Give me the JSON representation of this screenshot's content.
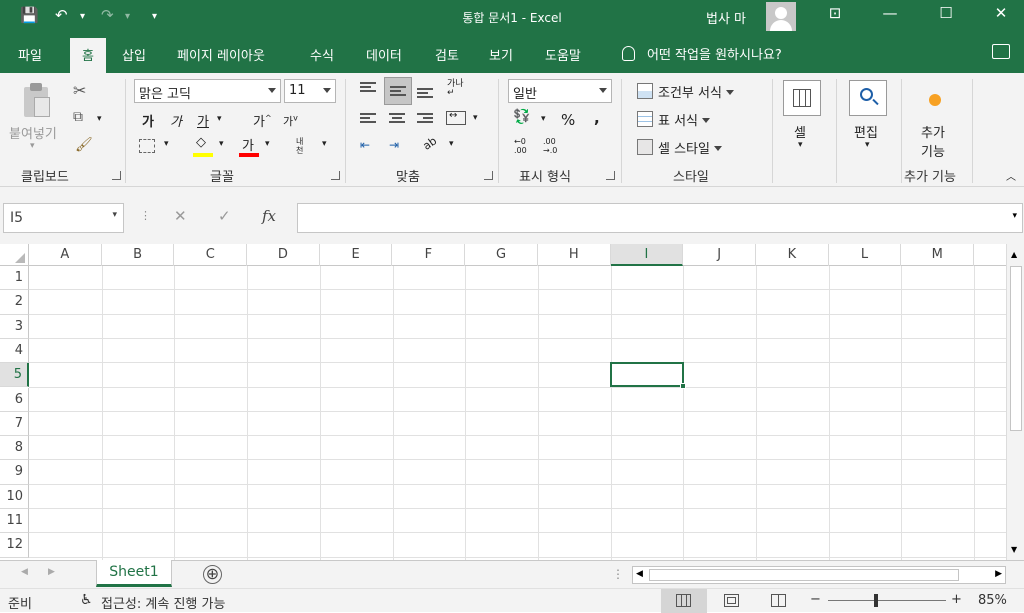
{
  "titlebar": {
    "doc_title": "통합 문서1  -  Excel",
    "user_name": "법사 마",
    "quick_access": {
      "save": "💾",
      "undo": "↶",
      "redo": "↷",
      "customize": "▾"
    },
    "window": {
      "ribbon_display": "⊡",
      "minimize": "—",
      "restore": "☐",
      "close": "✕"
    }
  },
  "tabs": [
    "파일",
    "홈",
    "삽입",
    "페이지 레이아웃",
    "수식",
    "데이터",
    "검토",
    "보기",
    "도움말"
  ],
  "active_tab": "홈",
  "tell_me": "어떤 작업을 원하시나요?",
  "ribbon": {
    "clipboard": {
      "paste_label": "붙여넣기",
      "group_label": "클립보드"
    },
    "font": {
      "font_name": "맑은 고딕",
      "font_size": "11",
      "bold": "가",
      "italic": "가",
      "underline": "가",
      "grow": "가",
      "shrink": "가",
      "font_color_glyph": "가",
      "phonetic": "내천",
      "group_label": "글꼴",
      "fill_color": "#ffff00",
      "font_color": "#ff0000"
    },
    "alignment": {
      "orientation": "ab",
      "group_label": "맞춤"
    },
    "number": {
      "format": "일반",
      "percent": "%",
      "comma": ",",
      "inc_decimal_top": "←0",
      "inc_decimal_bottom": ".00",
      "dec_decimal_top": ".00",
      "dec_decimal_bottom": "→.0",
      "group_label": "표시 형식"
    },
    "styles": {
      "conditional": "조건부 서식",
      "table": "표 서식",
      "cell_styles": "셀 스타일",
      "group_label": "스타일"
    },
    "cells": {
      "label": "셀"
    },
    "editing": {
      "label": "편집"
    },
    "addins": {
      "label_line1": "추가",
      "label_line2": "기능",
      "group_label": "추가 기능"
    }
  },
  "formula_bar": {
    "name_box": "I5",
    "fx": "fx",
    "cancel": "✕",
    "enter": "✓",
    "value": ""
  },
  "columns": [
    "A",
    "B",
    "C",
    "D",
    "E",
    "F",
    "G",
    "H",
    "I",
    "J",
    "K",
    "L",
    "M"
  ],
  "rows": [
    "1",
    "2",
    "3",
    "4",
    "5",
    "6",
    "7",
    "8",
    "9",
    "10",
    "11",
    "12"
  ],
  "selected_cell": {
    "column": "I",
    "row": "5"
  },
  "sheets": [
    "Sheet1"
  ],
  "add_sheet": "⊕",
  "status": {
    "ready": "준비",
    "accessibility": "접근성: 계속 진행 가능",
    "zoom": "85%",
    "zoom_minus": "−",
    "zoom_plus": "+"
  },
  "colors": {
    "brand": "#217346",
    "ribbon_bg": "#f3f3f3"
  }
}
